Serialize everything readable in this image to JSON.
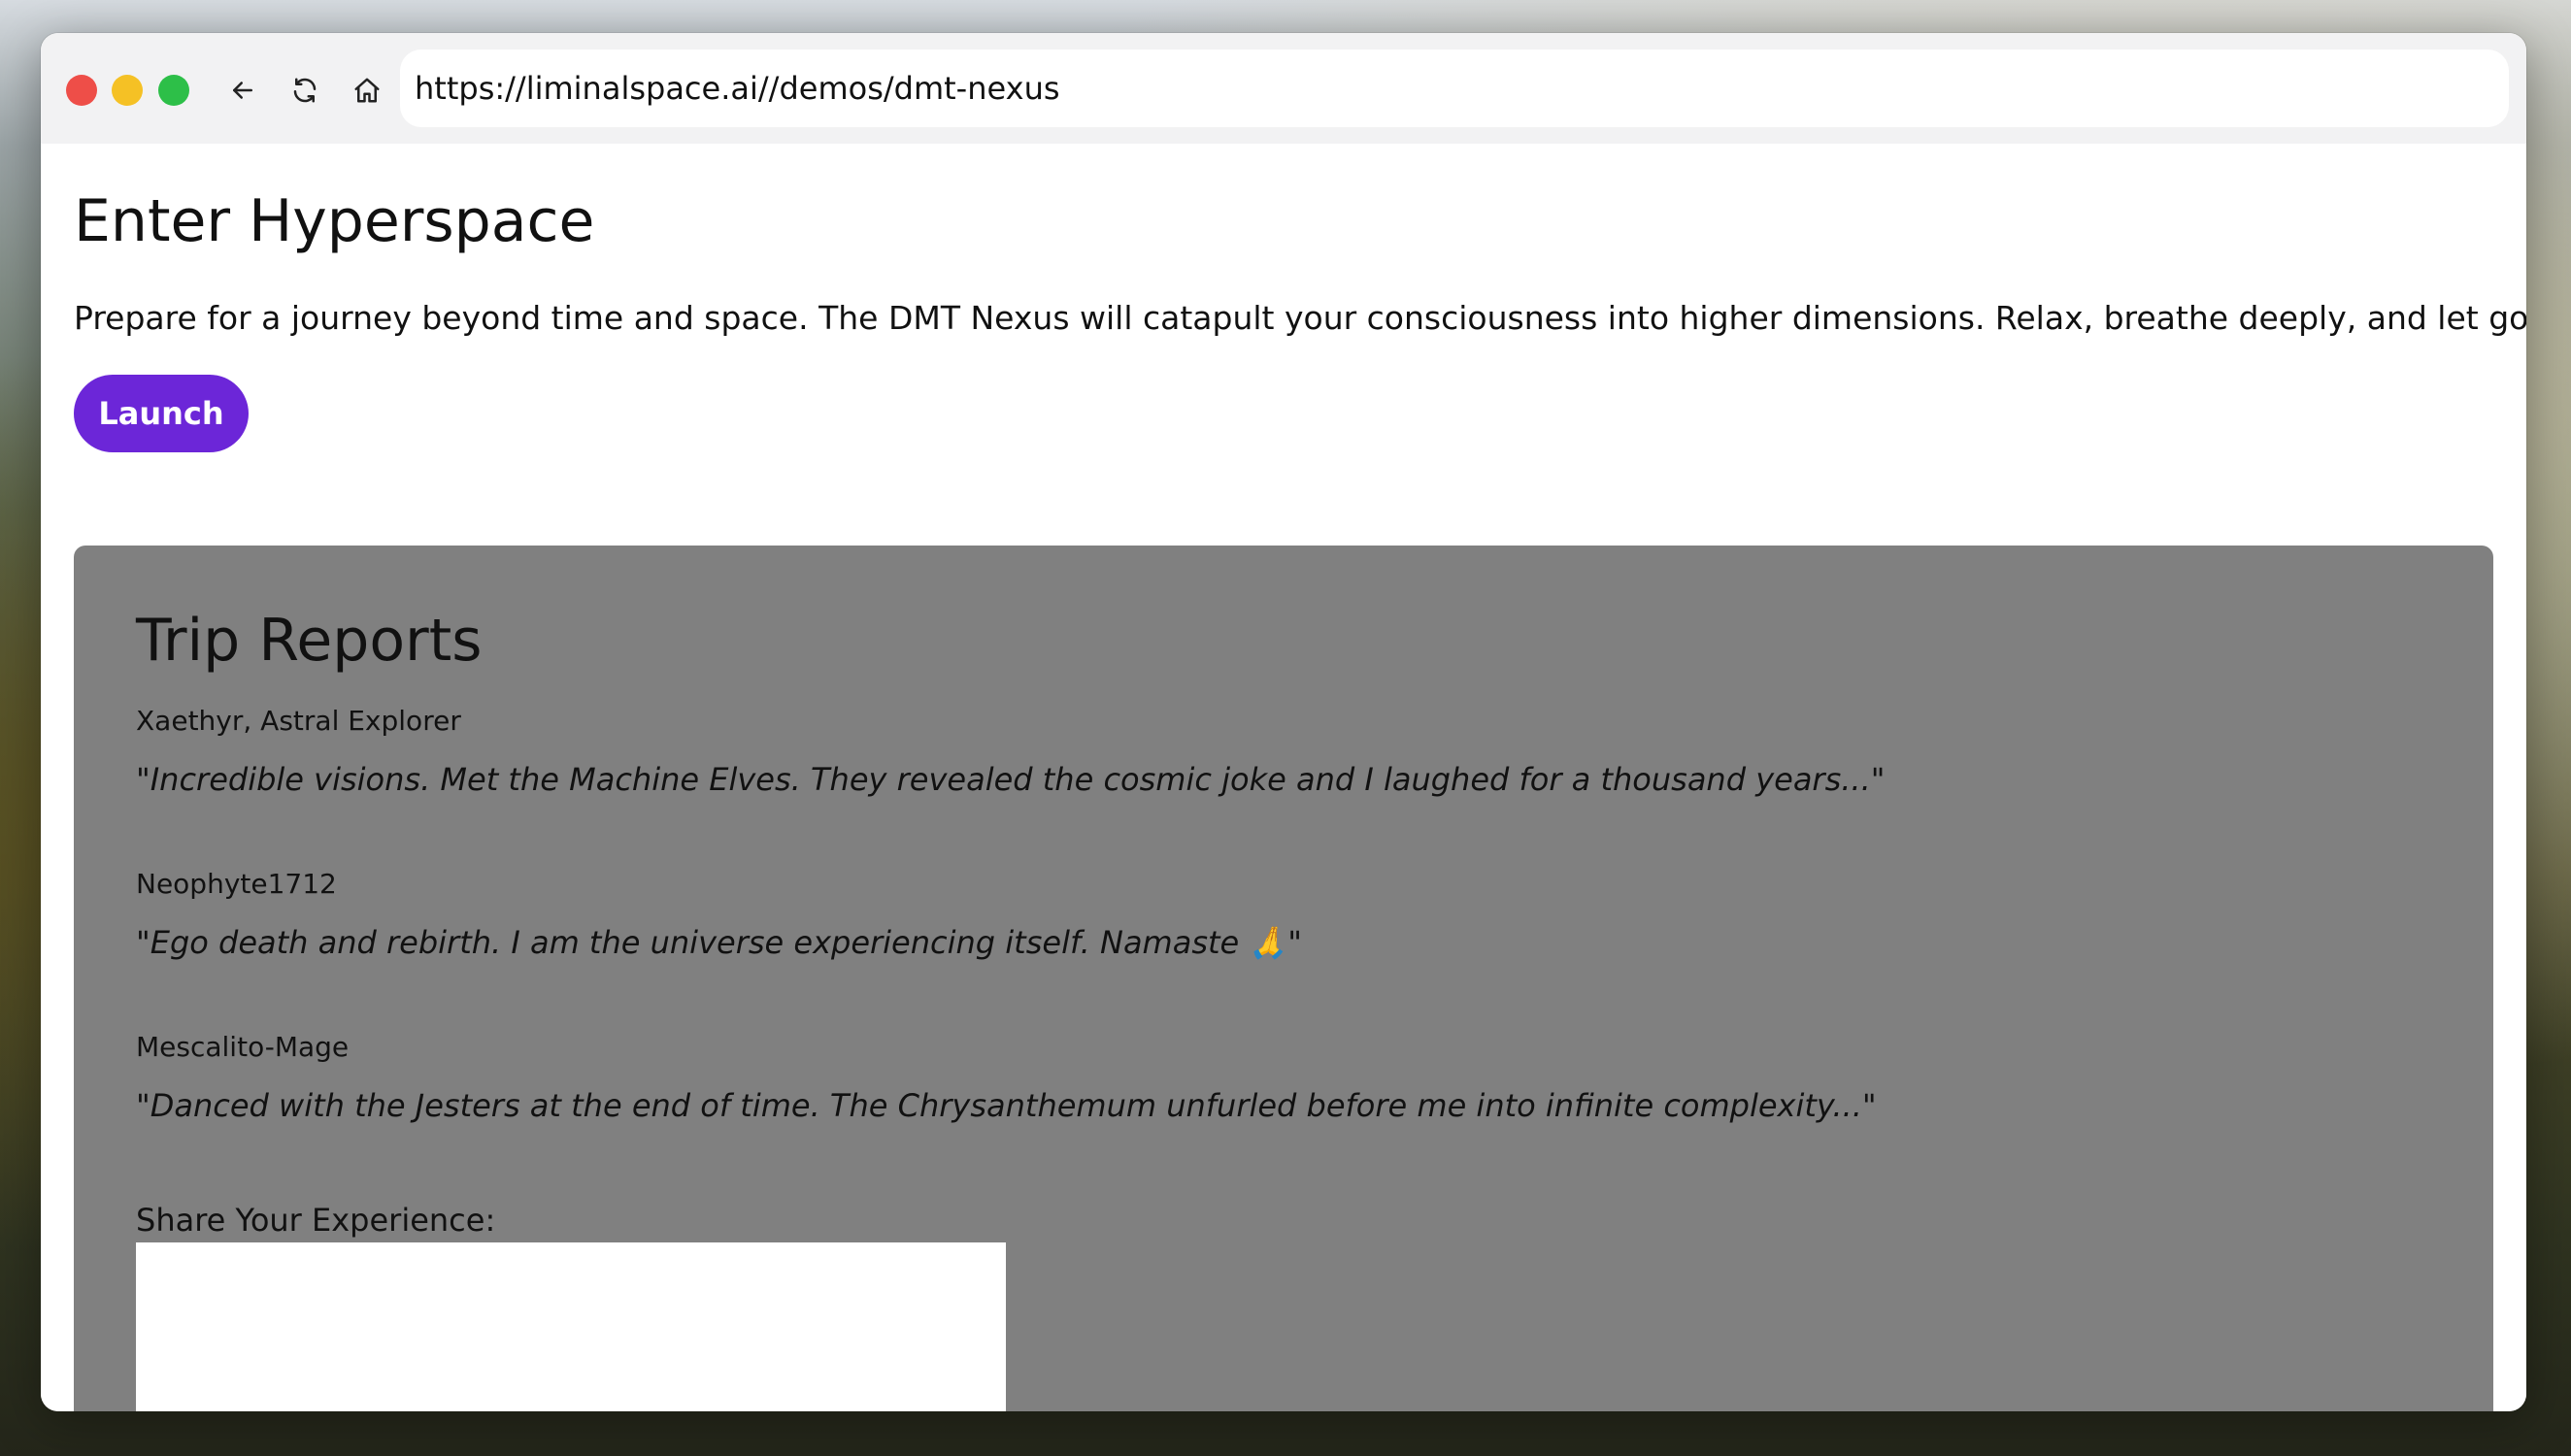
{
  "browser": {
    "url": "https://liminalspace.ai//demos/dmt-nexus"
  },
  "page": {
    "title": "Enter Hyperspace",
    "intro": "Prepare for a journey beyond time and space. The DMT Nexus will catapult your consciousness into higher dimensions. Relax, breathe deeply, and let go...",
    "launch_label": "Launch"
  },
  "reports": {
    "title": "Trip Reports",
    "items": [
      {
        "author": "Xaethyr, Astral Explorer",
        "quote": "\"Incredible visions. Met the Machine Elves. They revealed the cosmic joke and I laughed for a thousand years...\""
      },
      {
        "author": "Neophyte1712",
        "quote": "\"Ego death and rebirth. I am the universe experiencing itself. Namaste 🙏\""
      },
      {
        "author": "Mescalito-Mage",
        "quote": "\"Danced with the Jesters at the end of time. The Chrysanthemum unfurled before me into infinite complexity...\""
      }
    ],
    "share_label": "Share Your Experience:",
    "share_value": ""
  }
}
